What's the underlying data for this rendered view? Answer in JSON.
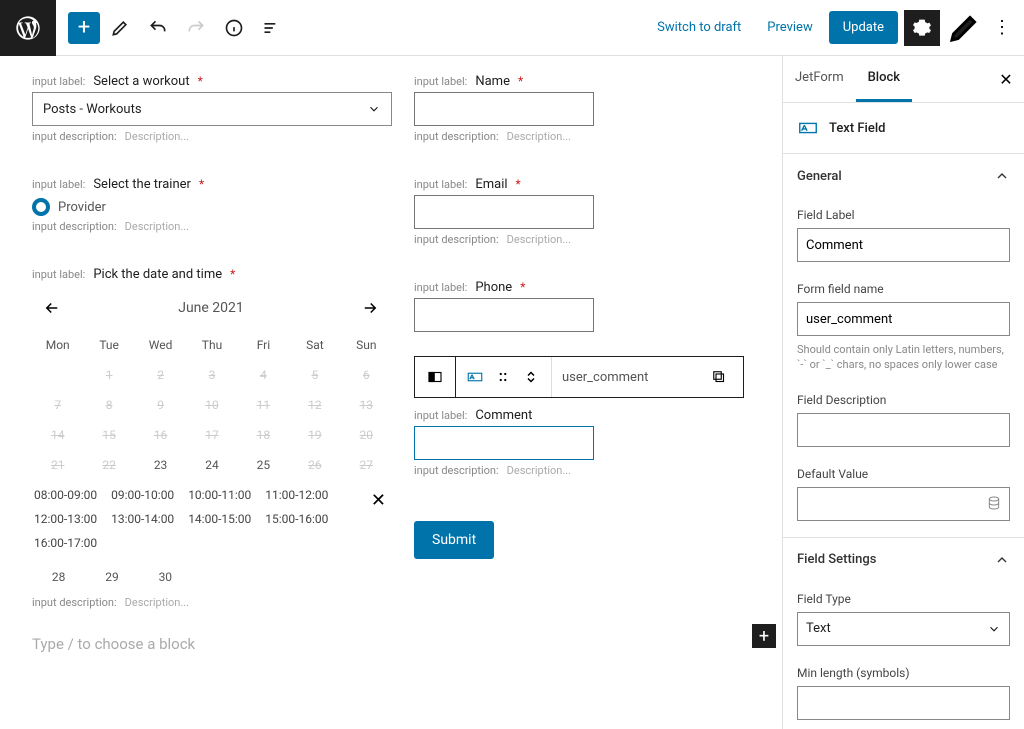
{
  "toolbar": {
    "switch_draft": "Switch to draft",
    "preview": "Preview",
    "update": "Update"
  },
  "form": {
    "label_prefix": "input label:",
    "desc_prefix": "input description:",
    "desc_placeholder": "Description...",
    "workout": {
      "label": "Select a workout",
      "value": "Posts - Workouts"
    },
    "trainer": {
      "label": "Select the trainer",
      "option": "Provider"
    },
    "datetime": {
      "label": "Pick the date and time",
      "month": "June 2021",
      "day_headers": [
        "Mon",
        "Tue",
        "Wed",
        "Thu",
        "Fri",
        "Sat",
        "Sun"
      ],
      "weeks": [
        [
          {
            "d": "",
            "off": true
          },
          {
            "d": "1",
            "off": true
          },
          {
            "d": "2",
            "off": true
          },
          {
            "d": "3",
            "off": true
          },
          {
            "d": "4",
            "off": true
          },
          {
            "d": "5",
            "off": true
          },
          {
            "d": "6",
            "off": true
          }
        ],
        [
          {
            "d": "7",
            "off": true
          },
          {
            "d": "8",
            "off": true
          },
          {
            "d": "9",
            "off": true
          },
          {
            "d": "10",
            "off": true
          },
          {
            "d": "11",
            "off": true
          },
          {
            "d": "12",
            "off": true
          },
          {
            "d": "13",
            "off": true
          }
        ],
        [
          {
            "d": "14",
            "off": true
          },
          {
            "d": "15",
            "off": true
          },
          {
            "d": "16",
            "off": true
          },
          {
            "d": "17",
            "off": true
          },
          {
            "d": "18",
            "off": true
          },
          {
            "d": "19",
            "off": true
          },
          {
            "d": "20",
            "off": true
          }
        ],
        [
          {
            "d": "21",
            "off": true
          },
          {
            "d": "22",
            "off": true
          },
          {
            "d": "23",
            "off": false
          },
          {
            "d": "24",
            "off": false
          },
          {
            "d": "25",
            "off": false
          },
          {
            "d": "26",
            "off": true
          },
          {
            "d": "27",
            "off": true
          }
        ]
      ],
      "slots": [
        "08:00-09:00",
        "09:00-10:00",
        "10:00-11:00",
        "11:00-12:00",
        "12:00-13:00",
        "13:00-14:00",
        "14:00-15:00",
        "15:00-16:00",
        "16:00-17:00"
      ],
      "extra_days": [
        "28",
        "29",
        "30"
      ]
    },
    "name": {
      "label": "Name"
    },
    "email": {
      "label": "Email"
    },
    "phone": {
      "label": "Phone"
    },
    "comment": {
      "label": "Comment"
    },
    "block_field_name": "user_comment",
    "submit": "Submit",
    "prompt": "Type / to choose a block"
  },
  "sidebar": {
    "tabs": {
      "jetform": "JetForm",
      "block": "Block"
    },
    "block_type": "Text Field",
    "general_title": "General",
    "field_label": {
      "lbl": "Field Label",
      "val": "Comment"
    },
    "field_name": {
      "lbl": "Form field name",
      "val": "user_comment",
      "help": "Should contain only Latin letters, numbers, `-` or `_` chars, no spaces only lower case"
    },
    "field_desc": {
      "lbl": "Field Description",
      "val": ""
    },
    "default_value": {
      "lbl": "Default Value",
      "val": ""
    },
    "settings_title": "Field Settings",
    "field_type": {
      "lbl": "Field Type",
      "val": "Text"
    },
    "min_length": {
      "lbl": "Min length (symbols)",
      "val": ""
    }
  }
}
